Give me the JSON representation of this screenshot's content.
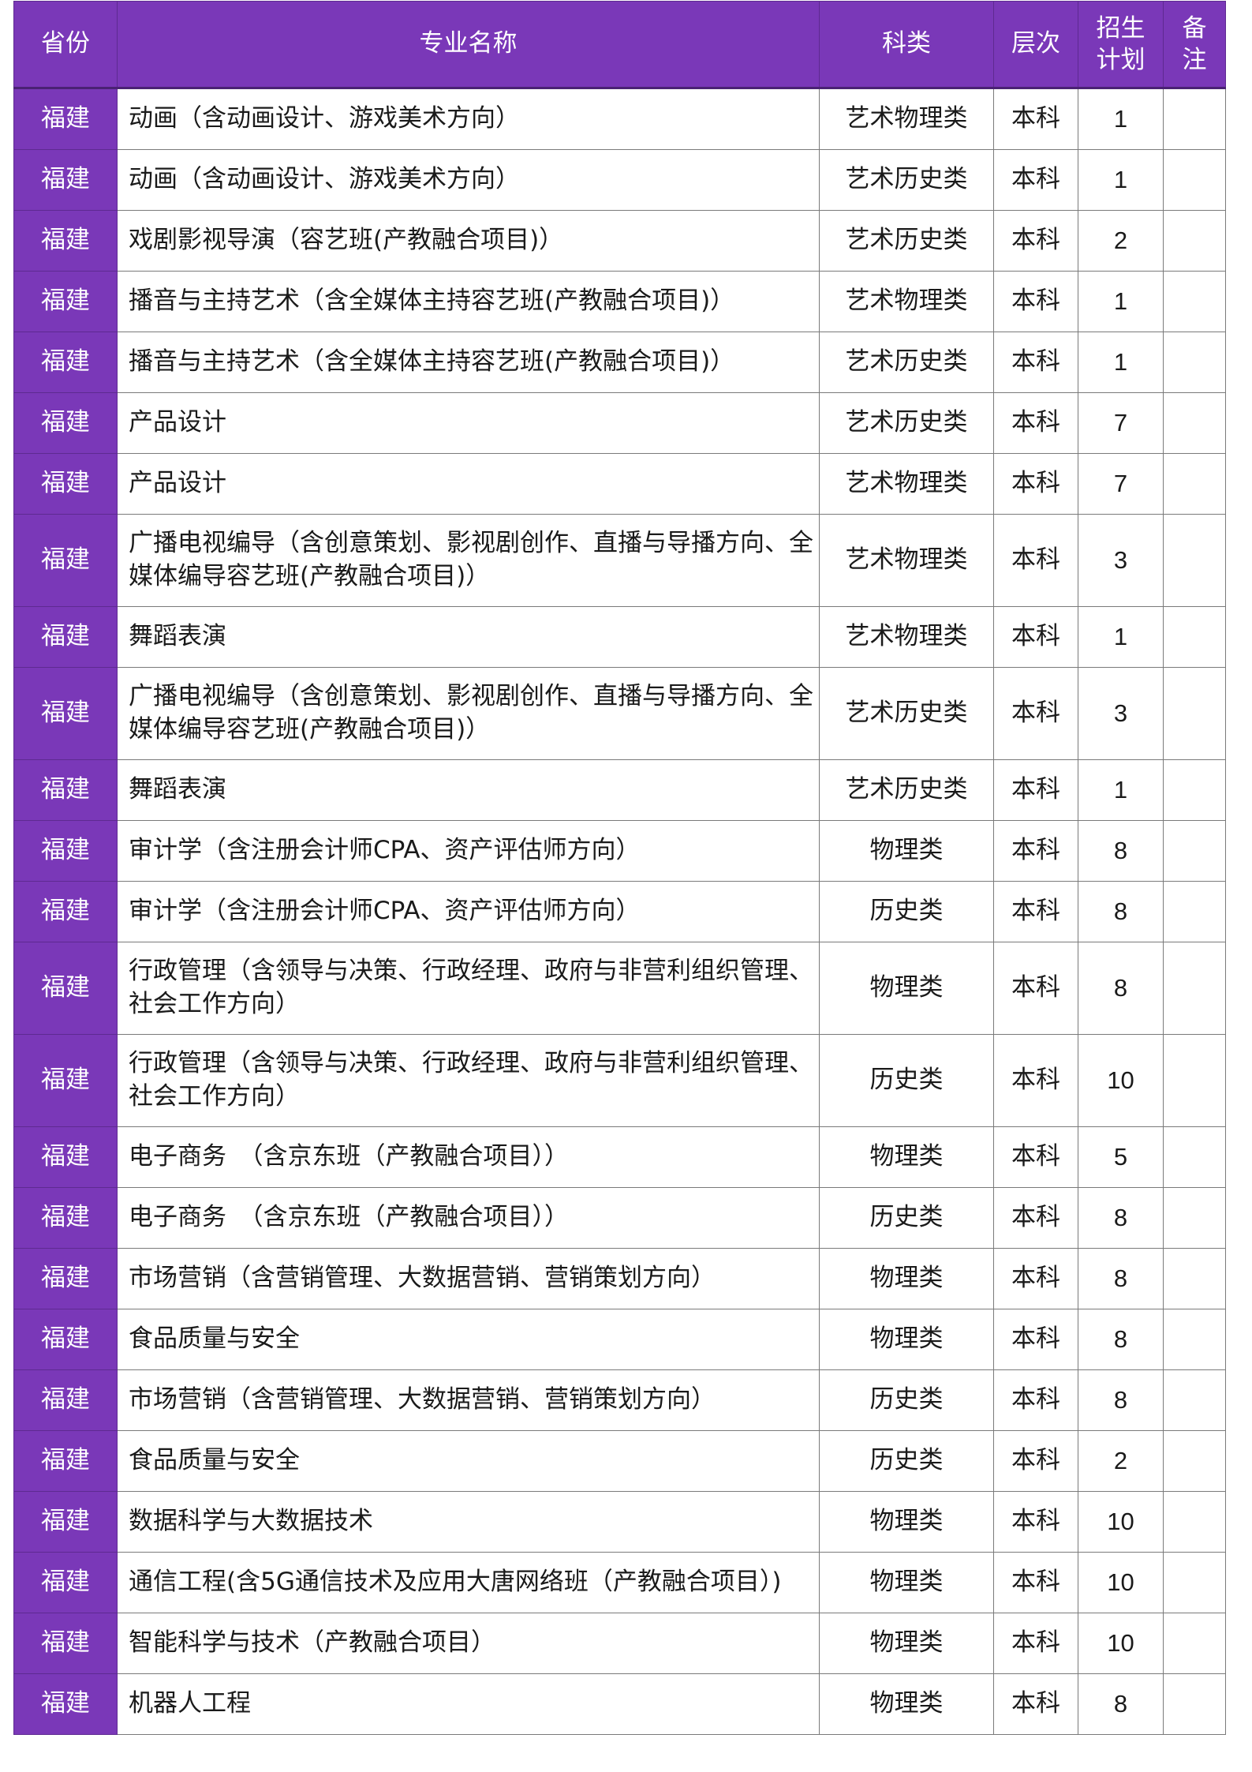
{
  "header": {
    "province": "省份",
    "major": "专业名称",
    "category": "科类",
    "level": "层次",
    "plan_line1": "招生",
    "plan_line2": "计划",
    "note_line1": "备",
    "note_line2": "注"
  },
  "rows": [
    {
      "province": "福建",
      "major": "动画（含动画设计、游戏美术方向）",
      "category": "艺术物理类",
      "level": "本科",
      "plan": "1",
      "note": ""
    },
    {
      "province": "福建",
      "major": "动画（含动画设计、游戏美术方向）",
      "category": "艺术历史类",
      "level": "本科",
      "plan": "1",
      "note": ""
    },
    {
      "province": "福建",
      "major": "戏剧影视导演（容艺班(产教融合项目)）",
      "category": "艺术历史类",
      "level": "本科",
      "plan": "2",
      "note": ""
    },
    {
      "province": "福建",
      "major": "播音与主持艺术（含全媒体主持容艺班(产教融合项目)）",
      "category": "艺术物理类",
      "level": "本科",
      "plan": "1",
      "note": ""
    },
    {
      "province": "福建",
      "major": "播音与主持艺术（含全媒体主持容艺班(产教融合项目)）",
      "category": "艺术历史类",
      "level": "本科",
      "plan": "1",
      "note": ""
    },
    {
      "province": "福建",
      "major": "产品设计",
      "category": "艺术历史类",
      "level": "本科",
      "plan": "7",
      "note": ""
    },
    {
      "province": "福建",
      "major": "产品设计",
      "category": "艺术物理类",
      "level": "本科",
      "plan": "7",
      "note": ""
    },
    {
      "province": "福建",
      "major": "广播电视编导（含创意策划、影视剧创作、直播与导播方向、全媒体编导容艺班(产教融合项目)）",
      "category": "艺术物理类",
      "level": "本科",
      "plan": "3",
      "note": ""
    },
    {
      "province": "福建",
      "major": "舞蹈表演",
      "category": "艺术物理类",
      "level": "本科",
      "plan": "1",
      "note": ""
    },
    {
      "province": "福建",
      "major": "广播电视编导（含创意策划、影视剧创作、直播与导播方向、全媒体编导容艺班(产教融合项目)）",
      "category": "艺术历史类",
      "level": "本科",
      "plan": "3",
      "note": ""
    },
    {
      "province": "福建",
      "major": "舞蹈表演",
      "category": "艺术历史类",
      "level": "本科",
      "plan": "1",
      "note": ""
    },
    {
      "province": "福建",
      "major": "审计学（含注册会计师CPA、资产评估师方向）",
      "category": "物理类",
      "level": "本科",
      "plan": "8",
      "note": ""
    },
    {
      "province": "福建",
      "major": "审计学（含注册会计师CPA、资产评估师方向）",
      "category": "历史类",
      "level": "本科",
      "plan": "8",
      "note": ""
    },
    {
      "province": "福建",
      "major": "行政管理（含领导与决策、行政经理、政府与非营利组织管理、社会工作方向）",
      "category": "物理类",
      "level": "本科",
      "plan": "8",
      "note": ""
    },
    {
      "province": "福建",
      "major": "行政管理（含领导与决策、行政经理、政府与非营利组织管理、社会工作方向）",
      "category": "历史类",
      "level": "本科",
      "plan": "10",
      "note": ""
    },
    {
      "province": "福建",
      "major": "电子商务　（含京东班（产教融合项目））",
      "category": "物理类",
      "level": "本科",
      "plan": "5",
      "note": ""
    },
    {
      "province": "福建",
      "major": "电子商务　（含京东班（产教融合项目））",
      "category": "历史类",
      "level": "本科",
      "plan": "8",
      "note": ""
    },
    {
      "province": "福建",
      "major": "市场营销（含营销管理、大数据营销、营销策划方向）",
      "category": "物理类",
      "level": "本科",
      "plan": "8",
      "note": ""
    },
    {
      "province": "福建",
      "major": "食品质量与安全",
      "category": "物理类",
      "level": "本科",
      "plan": "8",
      "note": ""
    },
    {
      "province": "福建",
      "major": "市场营销（含营销管理、大数据营销、营销策划方向）",
      "category": "历史类",
      "level": "本科",
      "plan": "8",
      "note": ""
    },
    {
      "province": "福建",
      "major": "食品质量与安全",
      "category": "历史类",
      "level": "本科",
      "plan": "2",
      "note": ""
    },
    {
      "province": "福建",
      "major": "数据科学与大数据技术",
      "category": "物理类",
      "level": "本科",
      "plan": "10",
      "note": ""
    },
    {
      "province": "福建",
      "major": "通信工程(含5G通信技术及应用大唐网络班（产教融合项目）)",
      "category": "物理类",
      "level": "本科",
      "plan": "10",
      "note": ""
    },
    {
      "province": "福建",
      "major": "智能科学与技术（产教融合项目）",
      "category": "物理类",
      "level": "本科",
      "plan": "10",
      "note": ""
    },
    {
      "province": "福建",
      "major": "机器人工程",
      "category": "物理类",
      "level": "本科",
      "plan": "8",
      "note": ""
    }
  ]
}
